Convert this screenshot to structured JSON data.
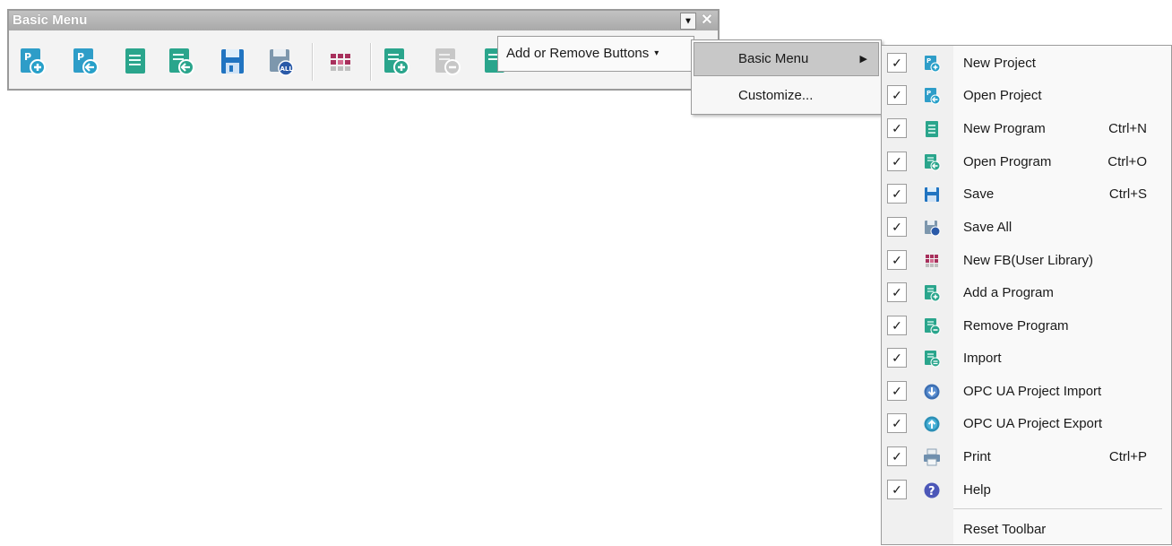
{
  "toolbar": {
    "title": "Basic Menu",
    "dropdown_glyph": "▾",
    "close_glyph": "✕",
    "icons": [
      {
        "name": "new-project",
        "color": "#2aa0c8"
      },
      {
        "name": "open-project",
        "color": "#2aa0c8"
      },
      {
        "name": "new-program",
        "color": "#2aa08a"
      },
      {
        "name": "open-program",
        "color": "#2aa08a"
      },
      {
        "name": "save",
        "color": "#1f6fbf"
      },
      {
        "name": "save-all",
        "color": "#6e8aa3"
      },
      {
        "name": "new-fb",
        "color": "#a0305a"
      },
      {
        "name": "add-a-program",
        "color": "#2aa08a"
      },
      {
        "name": "remove-program",
        "color": "#b8b8b8"
      },
      {
        "name": "import",
        "color": "#2aa08a"
      }
    ]
  },
  "add_remove": {
    "label": "Add or Remove Buttons",
    "arrow": "▾"
  },
  "submenu": {
    "items": [
      {
        "label": "Basic Menu",
        "arrow": "▶"
      },
      {
        "label": "Customize..."
      }
    ]
  },
  "buttons_menu": {
    "check": "✓",
    "items": [
      {
        "label": "New Project",
        "shortcut": "",
        "icon": "new-project-icon",
        "checked": true
      },
      {
        "label": "Open Project",
        "shortcut": "",
        "icon": "open-project-icon",
        "checked": true
      },
      {
        "label": "New Program",
        "shortcut": "Ctrl+N",
        "icon": "new-program-icon",
        "checked": true
      },
      {
        "label": "Open Program",
        "shortcut": "Ctrl+O",
        "icon": "open-program-icon",
        "checked": true
      },
      {
        "label": "Save",
        "shortcut": "Ctrl+S",
        "icon": "save-icon",
        "checked": true
      },
      {
        "label": "Save All",
        "shortcut": "",
        "icon": "save-all-icon",
        "checked": true
      },
      {
        "label": "New FB(User Library)",
        "shortcut": "",
        "icon": "new-fb-icon",
        "checked": true
      },
      {
        "label": "Add a Program",
        "shortcut": "",
        "icon": "add-program-icon",
        "checked": true
      },
      {
        "label": "Remove Program",
        "shortcut": "",
        "icon": "remove-program-icon",
        "checked": true
      },
      {
        "label": "Import",
        "shortcut": "",
        "icon": "import-icon",
        "checked": true
      },
      {
        "label": "OPC UA Project Import",
        "shortcut": "",
        "icon": "opc-import-icon",
        "checked": true
      },
      {
        "label": "OPC UA Project Export",
        "shortcut": "",
        "icon": "opc-export-icon",
        "checked": true
      },
      {
        "label": "Print",
        "shortcut": "Ctrl+P",
        "icon": "print-icon",
        "checked": true
      },
      {
        "label": "Help",
        "shortcut": "",
        "icon": "help-icon",
        "checked": true
      }
    ],
    "reset_label": "Reset Toolbar"
  }
}
